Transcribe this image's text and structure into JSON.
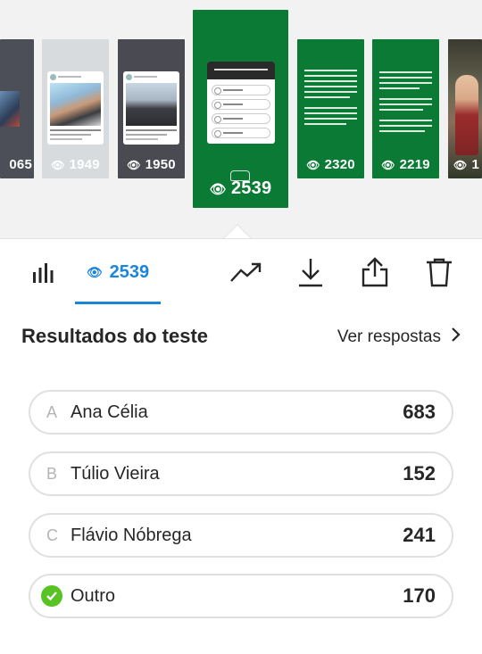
{
  "stories": [
    {
      "views": "065"
    },
    {
      "views": "1949"
    },
    {
      "views": "1950"
    },
    {
      "views": "2539"
    },
    {
      "views": "2320"
    },
    {
      "views": "2219"
    },
    {
      "views": "1"
    }
  ],
  "toolbar": {
    "views_count": "2539",
    "icons": [
      "bar-chart-icon",
      "eye-icon",
      "trending-up-icon",
      "download-icon",
      "share-icon",
      "trash-icon"
    ]
  },
  "results": {
    "title": "Resultados do teste",
    "see_answers": "Ver respostas",
    "options": [
      {
        "letter": "A",
        "label": "Ana Célia",
        "count": "683",
        "correct": false
      },
      {
        "letter": "B",
        "label": "Túlio Vieira",
        "count": "152",
        "correct": false
      },
      {
        "letter": "C",
        "label": "Flávio Nóbrega",
        "count": "241",
        "correct": false
      },
      {
        "letter": "",
        "label": "Outro",
        "count": "170",
        "correct": true
      }
    ]
  },
  "colors": {
    "accent": "#1a86d9",
    "story_green": "#0a7a34",
    "correct_green": "#58c322"
  }
}
